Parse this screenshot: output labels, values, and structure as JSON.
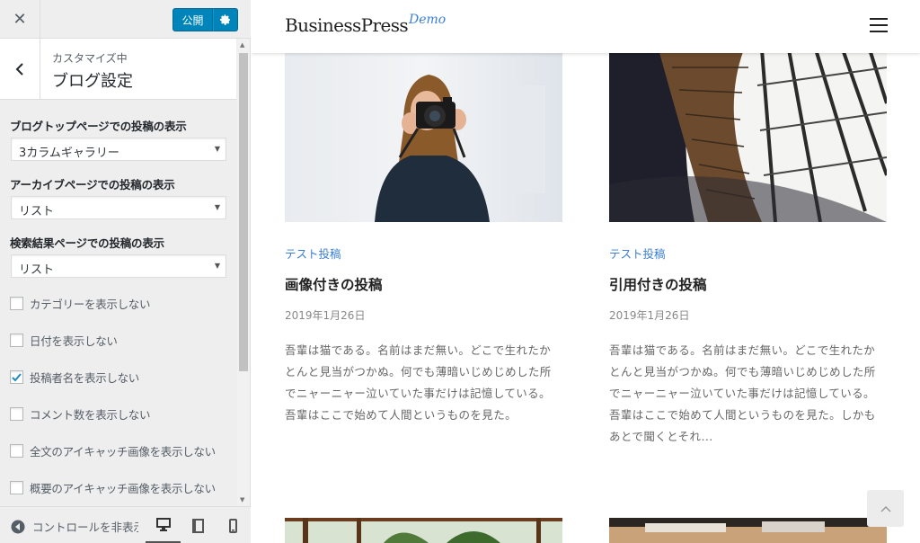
{
  "customizer": {
    "close_icon": "close-icon",
    "publish_label": "公開",
    "publish_settings_icon": "gear-icon",
    "section": {
      "customizing_label": "カスタマイズ中",
      "title": "ブログ設定"
    },
    "selects": [
      {
        "label": "ブログトップページでの投稿の表示",
        "value": "3カラムギャラリー"
      },
      {
        "label": "アーカイブページでの投稿の表示",
        "value": "リスト"
      },
      {
        "label": "検索結果ページでの投稿の表示",
        "value": "リスト"
      }
    ],
    "checkboxes": [
      {
        "label": "カテゴリーを表示しない",
        "checked": false
      },
      {
        "label": "日付を表示しない",
        "checked": false
      },
      {
        "label": "投稿者名を表示しない",
        "checked": true
      },
      {
        "label": "コメント数を表示しない",
        "checked": false
      },
      {
        "label": "全文のアイキャッチ画像を表示しない",
        "checked": false
      },
      {
        "label": "概要のアイキャッチ画像を表示しない",
        "checked": false
      }
    ],
    "footer": {
      "collapse_label": "コントロールを非表示",
      "devices": [
        "desktop",
        "tablet",
        "mobile"
      ],
      "active_device": "desktop"
    },
    "accent_color": "#0085ba"
  },
  "preview": {
    "site_title": "BusinessPress",
    "site_tagline": "Demo",
    "link_color": "#3a7fd5",
    "posts": [
      {
        "category": "テスト投稿",
        "title": "画像付きの投稿",
        "date": "2019年1月26日",
        "excerpt_lines": [
          "吾輩は猫である。名前はまだ無い。どこで生れたか",
          "とんと見当がつかぬ。何でも薄暗いじめじめした所",
          "でニャーニャー泣いていた事だけは記憶している。",
          "吾輩はここで始めて人間というものを見た。"
        ],
        "image": "woman-with-camera"
      },
      {
        "category": "テスト投稿",
        "title": "引用付きの投稿",
        "date": "2019年1月26日",
        "excerpt_lines": [
          "吾輩は猫である。名前はまだ無い。どこで生れたか",
          "とんと見当がつかぬ。何でも薄暗いじめじめした所",
          "でニャーニャー泣いていた事だけは記憶している。",
          "吾輩はここで始めて人間というものを見た。しかも",
          "あとで聞くとそれ..."
        ],
        "image": "library-bookshelves"
      }
    ],
    "next_row_images": [
      "trees-photo",
      "wood-desk-photo"
    ],
    "to_top_icon": "chevron-up-icon"
  }
}
